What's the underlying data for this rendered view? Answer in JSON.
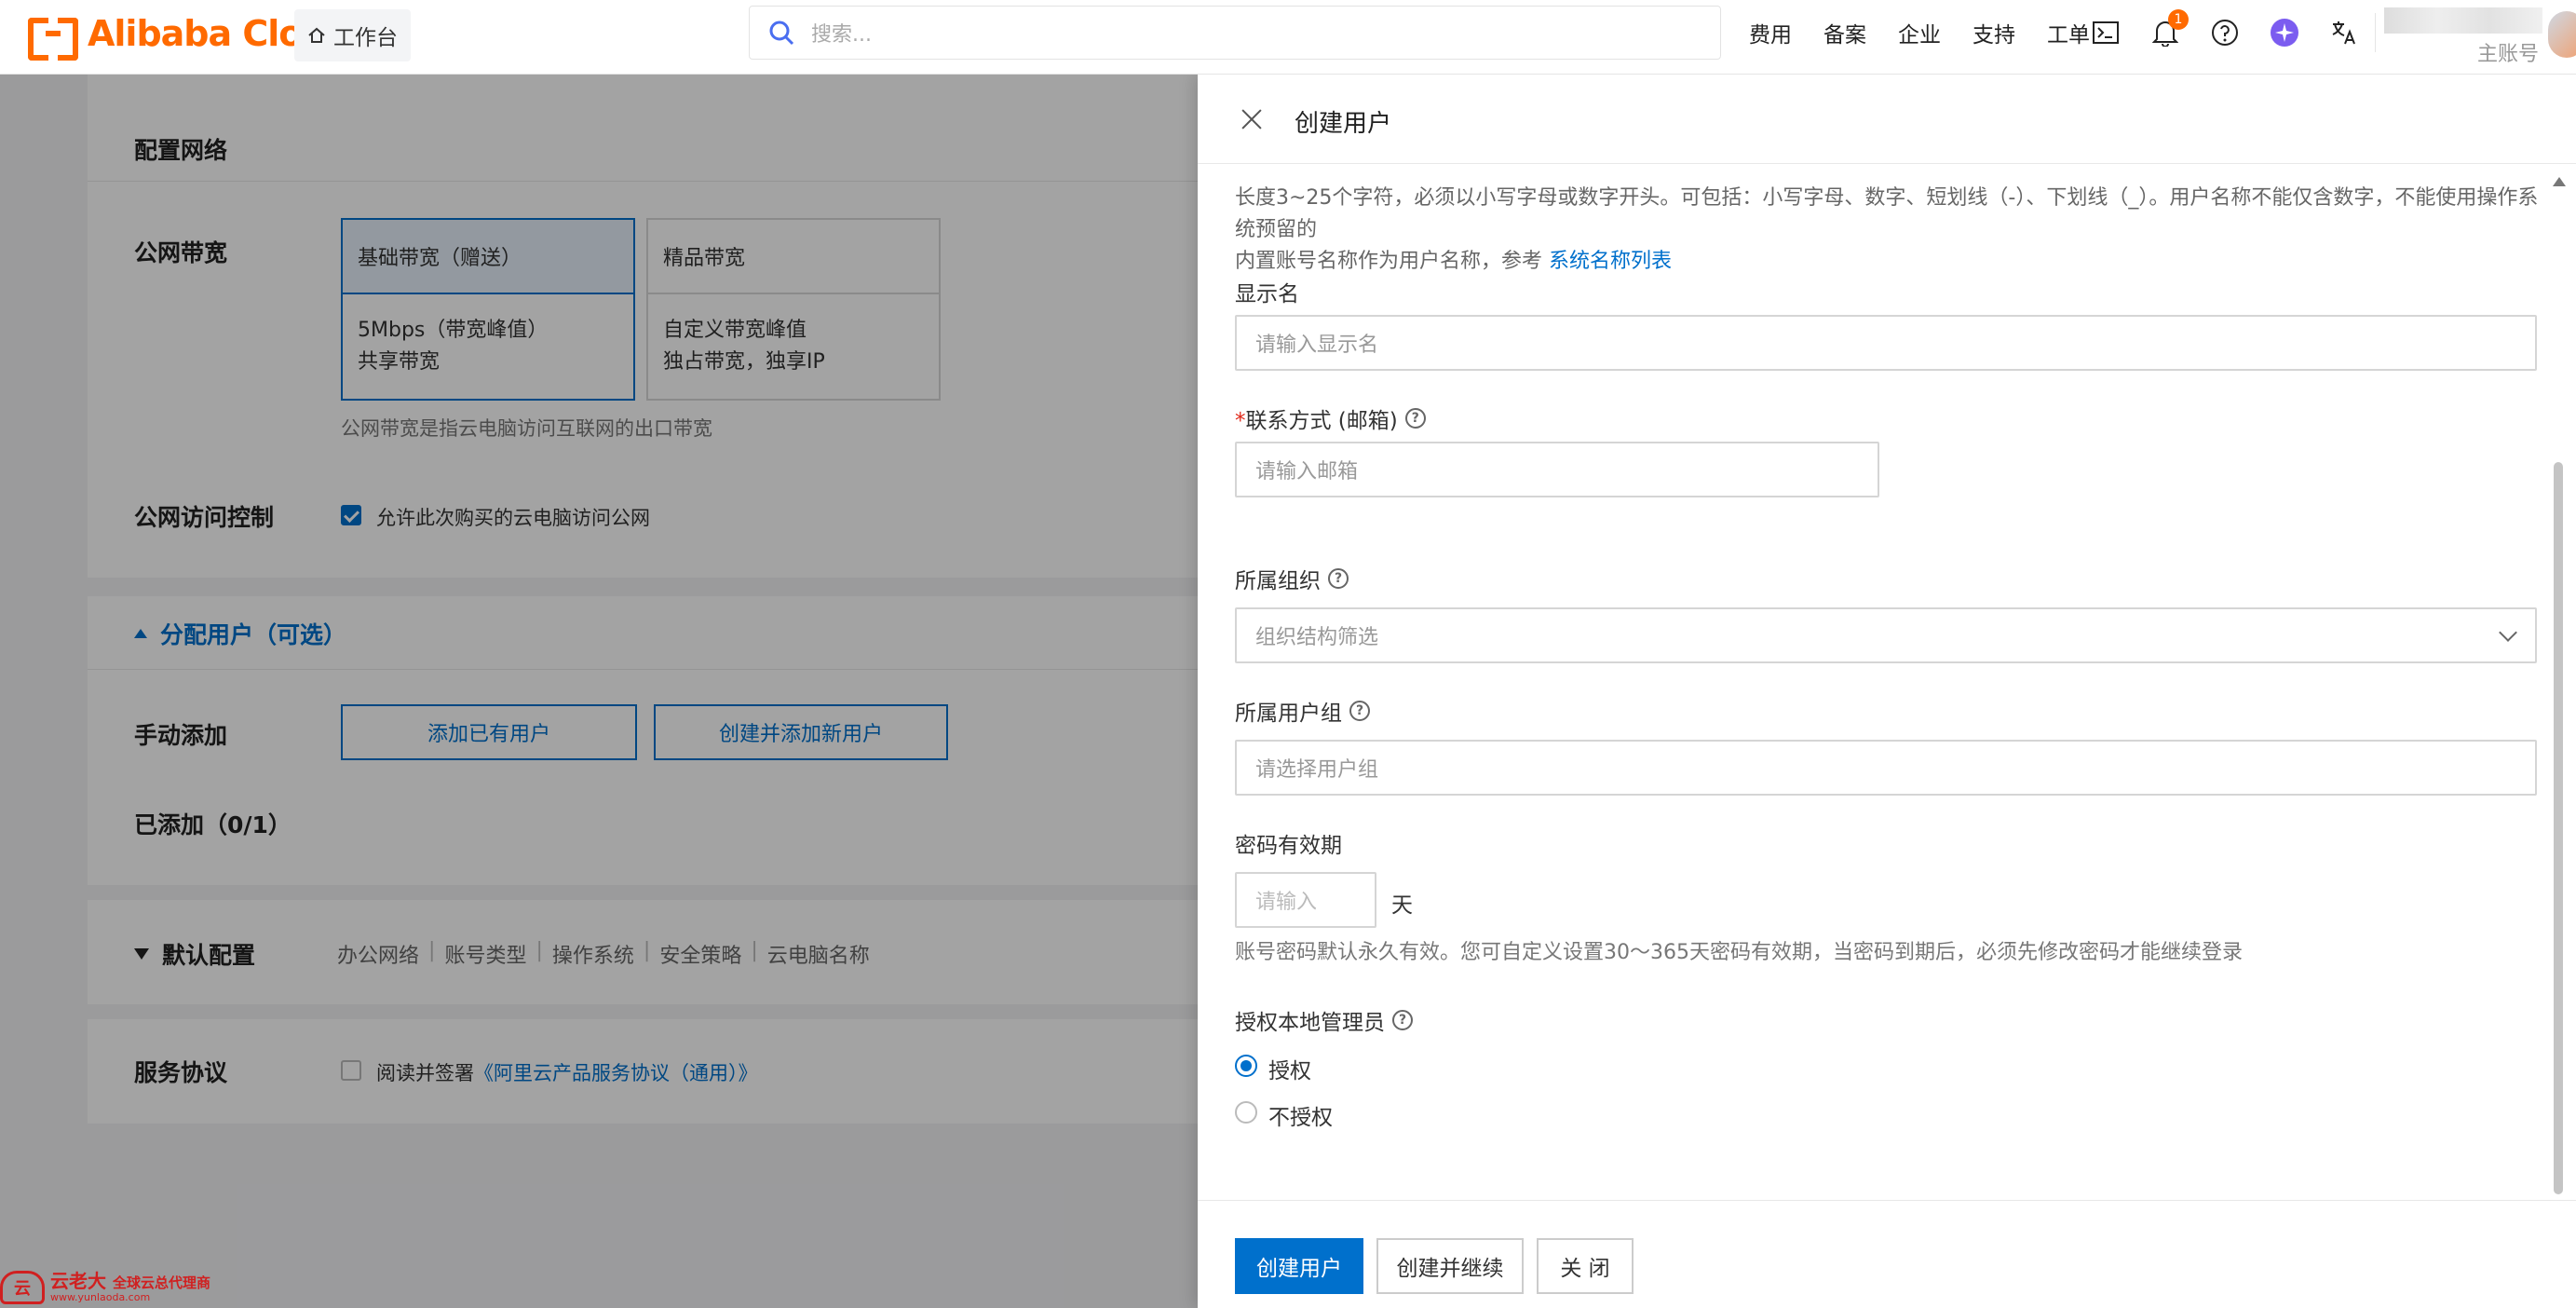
{
  "topbar": {
    "brand": "Alibaba Cloud",
    "workbench": "工作台",
    "search_placeholder": "搜索...",
    "nav_links": [
      "费用",
      "备案",
      "企业",
      "支持",
      "工单"
    ],
    "notification_count": "1",
    "account_label": "主账号",
    "accent": "#ff6a00"
  },
  "page": {
    "network_title": "配置网络",
    "bandwidth_label": "公网带宽",
    "bandwidth_options": [
      {
        "title": "基础带宽（赠送）",
        "line1": "5Mbps（带宽峰值）",
        "line2": "共享带宽"
      },
      {
        "title": "精品带宽",
        "line1": "自定义带宽峰值",
        "line2": "独占带宽，独享IP"
      }
    ],
    "bandwidth_hint": "公网带宽是指云电脑访问互联网的出口带宽",
    "access_label": "公网访问控制",
    "access_checkbox": "允许此次购买的云电脑访问公网",
    "assign_title": "分配用户（可选）",
    "manual_add_label": "手动添加",
    "add_existing_btn": "添加已有用户",
    "create_add_btn": "创建并添加新用户",
    "added_label": "已添加（0/1）",
    "default_config_title": "默认配置",
    "default_config_items": [
      "办公网络",
      "账号类型",
      "操作系统",
      "安全策略",
      "云电脑名称"
    ],
    "service_label": "服务协议",
    "agreement_prefix": "阅读并签署",
    "agreement_link": "《阿里云产品服务协议（通用）》"
  },
  "drawer": {
    "title": "创建用户",
    "username_hint_1": "长度3~25个字符，必须以小写字母或数字开头。可包括：小写字母、数字、短划线（-）、下划线（_）。用户名称不能仅含数字，不能使用操作系统预留的",
    "username_hint_2": "内置账号名称作为用户名称，参考",
    "system_names_link": "系统名称列表",
    "display_name_label": "显示名",
    "display_name_placeholder": "请输入显示名",
    "required_mark": "*",
    "email_label": "联系方式 (邮箱)",
    "email_placeholder": "请输入邮箱",
    "org_label": "所属组织",
    "org_placeholder": "组织结构筛选",
    "group_label": "所属用户组",
    "group_placeholder": "请选择用户组",
    "password_label": "密码有效期",
    "password_placeholder": "请输入",
    "password_unit": "天",
    "password_hint": "账号密码默认永久有效。您可自定义设置30～365天密码有效期，当密码到期后，必须先修改密码才能继续登录",
    "admin_label": "授权本地管理员",
    "admin_options": [
      "授权",
      "不授权"
    ],
    "admin_selected": "授权",
    "btn_create": "创建用户",
    "btn_create_continue": "创建并继续",
    "btn_close": "关 闭",
    "primary_color": "#0070cc"
  },
  "watermark": {
    "brand": "云老大",
    "slogan": "全球云总代理商",
    "url": "www.yunlaoda.com"
  }
}
